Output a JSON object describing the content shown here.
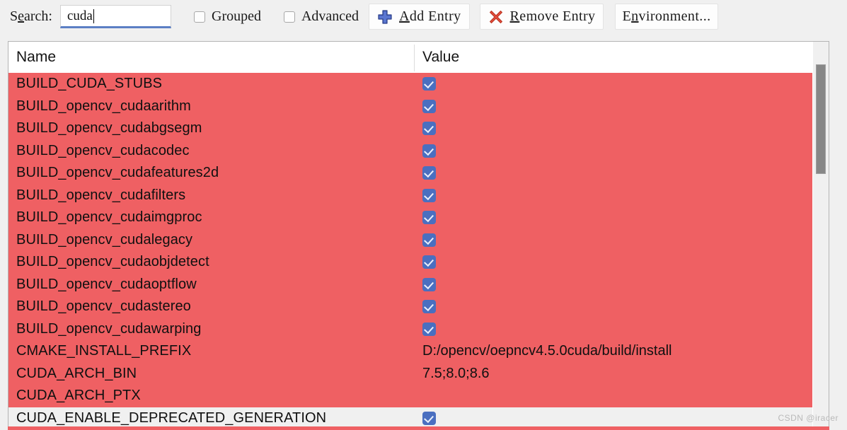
{
  "toolbar": {
    "search_label_prefix": "S",
    "search_label_acc": "e",
    "search_label_suffix": "arch:",
    "search_value": "cuda",
    "search_placeholder": "",
    "grouped_label": "Grouped",
    "advanced_label": "Advanced",
    "grouped_checked": false,
    "advanced_checked": false,
    "add_entry_acc": "A",
    "add_entry_rest": "dd Entry",
    "add_entry_icon": "plus-icon",
    "remove_entry_acc": "R",
    "remove_entry_rest": "emove Entry",
    "remove_entry_icon": "red-x-icon",
    "environment_pre": "E",
    "environment_acc": "n",
    "environment_rest": "vironment..."
  },
  "table": {
    "columns": [
      "Name",
      "Value"
    ],
    "rows": [
      {
        "name": "BUILD_CUDA_STUBS",
        "value": "",
        "checkbox": true,
        "highlight": true
      },
      {
        "name": "BUILD_opencv_cudaarithm",
        "value": "",
        "checkbox": true,
        "highlight": true
      },
      {
        "name": "BUILD_opencv_cudabgsegm",
        "value": "",
        "checkbox": true,
        "highlight": true
      },
      {
        "name": "BUILD_opencv_cudacodec",
        "value": "",
        "checkbox": true,
        "highlight": true
      },
      {
        "name": "BUILD_opencv_cudafeatures2d",
        "value": "",
        "checkbox": true,
        "highlight": true
      },
      {
        "name": "BUILD_opencv_cudafilters",
        "value": "",
        "checkbox": true,
        "highlight": true
      },
      {
        "name": "BUILD_opencv_cudaimgproc",
        "value": "",
        "checkbox": true,
        "highlight": true
      },
      {
        "name": "BUILD_opencv_cudalegacy",
        "value": "",
        "checkbox": true,
        "highlight": true
      },
      {
        "name": "BUILD_opencv_cudaobjdetect",
        "value": "",
        "checkbox": true,
        "highlight": true
      },
      {
        "name": "BUILD_opencv_cudaoptflow",
        "value": "",
        "checkbox": true,
        "highlight": true
      },
      {
        "name": "BUILD_opencv_cudastereo",
        "value": "",
        "checkbox": true,
        "highlight": true
      },
      {
        "name": "BUILD_opencv_cudawarping",
        "value": "",
        "checkbox": true,
        "highlight": true
      },
      {
        "name": "CMAKE_INSTALL_PREFIX",
        "value": "D:/opencv/oepncv4.5.0cuda/build/install",
        "checkbox": false,
        "highlight": true
      },
      {
        "name": "CUDA_ARCH_BIN",
        "value": "7.5;8.0;8.6",
        "checkbox": false,
        "highlight": true
      },
      {
        "name": "CUDA_ARCH_PTX",
        "value": "",
        "checkbox": false,
        "highlight": true
      },
      {
        "name": "CUDA_ENABLE_DEPRECATED_GENERATION",
        "value": "",
        "checkbox": true,
        "highlight": false
      }
    ]
  },
  "scrollbar": {
    "name": "vertical-scrollbar"
  },
  "watermark": {
    "text": "CSDN @iracer"
  },
  "colors": {
    "highlight_red": "#ef6063",
    "checkbox_blue": "#4a6fc0",
    "focus_underline": "#5b7fc4"
  }
}
